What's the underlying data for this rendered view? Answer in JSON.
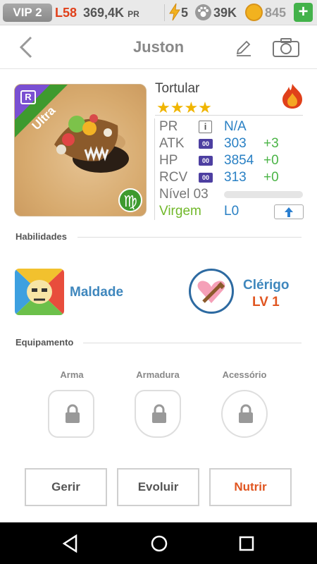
{
  "status": {
    "vip": "VIP 2",
    "level": "L58",
    "power": "369,4K",
    "power_unit": "PR",
    "energy": "5",
    "paws": "39K",
    "coins": "845",
    "plus": "+"
  },
  "header": {
    "title": "Juston"
  },
  "monster": {
    "rarity": "Ultra",
    "rarity_badge": "R",
    "zodiac_symbol": "♍",
    "name": "Tortular",
    "stars": "★★★★",
    "stars_count": 4,
    "pr_label": "PR",
    "pr_info": "i",
    "pr_value": "N/A",
    "atk_label": "ATK",
    "atk_value": "303",
    "atk_bonus": "+3",
    "hp_label": "HP",
    "hp_value": "3854",
    "hp_bonus": "+0",
    "rcv_label": "RCV",
    "rcv_value": "313",
    "rcv_bonus": "+0",
    "level_label": "Nível 03",
    "level_progress": 0,
    "zodiac": "Virgem",
    "zodiac_level": "L0"
  },
  "skills": {
    "title": "Habilidades",
    "skill1": "Maldade",
    "skill2": "Clérigo",
    "skill2_level": "LV 1"
  },
  "equipment": {
    "title": "Equipamento",
    "slots": [
      "Arma",
      "Armadura",
      "Acessório"
    ]
  },
  "actions": {
    "manage": "Gerir",
    "evolve": "Evoluir",
    "feed": "Nutrir"
  },
  "colors": {
    "accent_orange": "#e05520",
    "link_blue": "#3f87bd",
    "bonus_green": "#4ab446",
    "ultra_green": "#3e9a2e",
    "zodiac_green": "#71b82a"
  }
}
